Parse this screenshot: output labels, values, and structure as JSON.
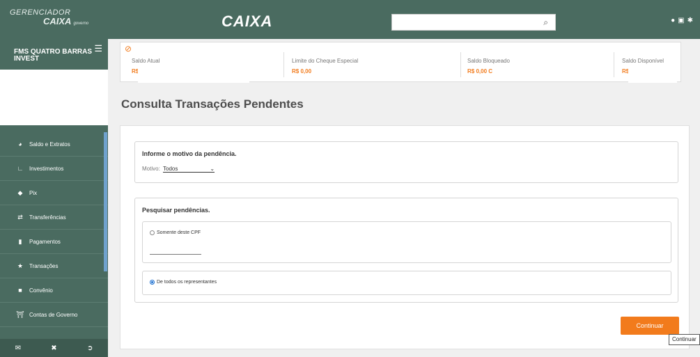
{
  "header": {
    "logo_line1": "GERENCIADOR",
    "logo_line2": "CAIXA",
    "logo_tag": "governo",
    "brand": "CAIXA",
    "search_placeholder": "",
    "icons": [
      "search-icon",
      "help-icon",
      "window-icon",
      "settings-icon"
    ]
  },
  "sidebar": {
    "account_name": "FMS QUATRO BARRAS INVEST",
    "items": [
      {
        "label": "Saldo e Extratos",
        "icon": "pie-chart-icon"
      },
      {
        "label": "Investimentos",
        "icon": "line-chart-icon"
      },
      {
        "label": "Pix",
        "icon": "pix-icon"
      },
      {
        "label": "Transferências",
        "icon": "transfer-icon"
      },
      {
        "label": "Pagamentos",
        "icon": "barcode-icon"
      },
      {
        "label": "Transações",
        "icon": "star-icon"
      },
      {
        "label": "Convênio",
        "icon": "document-icon"
      },
      {
        "label": "Contas de Governo",
        "icon": "bank-icon"
      }
    ],
    "footer_icons": [
      "mail-icon",
      "tools-icon",
      "logout-icon"
    ]
  },
  "saldo": {
    "atual_label": "Saldo Atual",
    "atual_value": "R$",
    "cheque_label": "Limite do Cheque Especial",
    "cheque_value": "R$ 0,00",
    "bloqueado_label": "Saldo Bloqueado",
    "bloqueado_value": "R$ 0,00 C",
    "disponivel_label": "Saldo Disponível",
    "disponivel_value": "R$"
  },
  "page": {
    "title": "Consulta Transações Pendentes"
  },
  "motivo_section": {
    "title": "Informe o motivo da pendência.",
    "label": "Motivo:",
    "selected": "Todos"
  },
  "pesquisar_section": {
    "title": "Pesquisar pendências.",
    "option_cpf": "Somente deste CPF",
    "option_todos": "De todos os representantes"
  },
  "actions": {
    "continuar_label": "Continuar",
    "tooltip": "Continuar"
  },
  "colors": {
    "header_bg": "#4a6b60",
    "accent": "#f27b1c"
  }
}
